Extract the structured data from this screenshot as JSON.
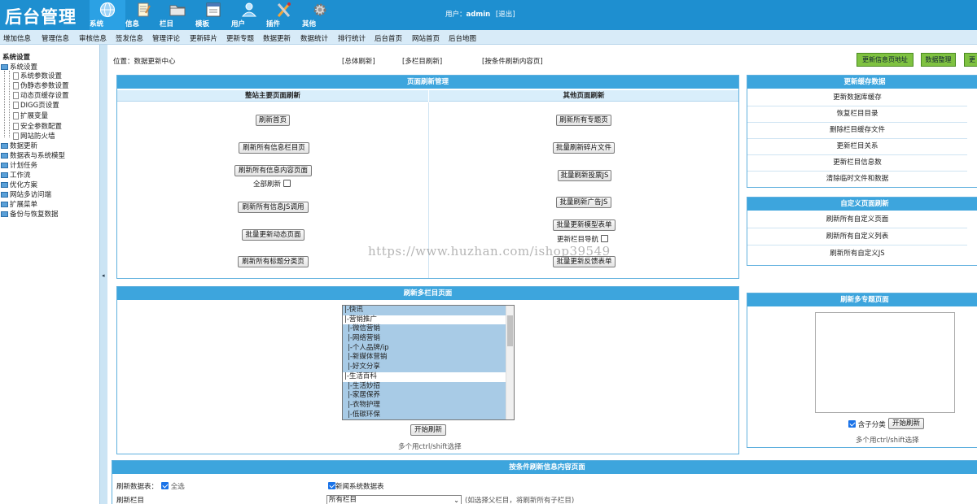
{
  "app": {
    "logo": "后台管理",
    "user_label": "用户：",
    "user_name": "admin",
    "logout": "[退出]"
  },
  "topnav": [
    {
      "label": "系统",
      "icon": "globe-icon",
      "active": true
    },
    {
      "label": "信息",
      "icon": "notepad-icon"
    },
    {
      "label": "栏目",
      "icon": "folder-icon"
    },
    {
      "label": "模板",
      "icon": "window-icon"
    },
    {
      "label": "用户",
      "icon": "user-icon"
    },
    {
      "label": "插件",
      "icon": "tools-icon"
    },
    {
      "label": "其他",
      "icon": "gear-icon"
    }
  ],
  "menubar": [
    "增加信息",
    "管理信息",
    "审核信息",
    "签发信息",
    "管理评论",
    "更新碎片",
    "更新专题",
    "数据更新",
    "数据统计",
    "排行统计",
    "后台首页",
    "网站首页",
    "后台地图"
  ],
  "sidebar": {
    "title": "系统设置",
    "groups": [
      {
        "label": "系统设置",
        "children": [
          "系统参数设置",
          "伪静态参数设置",
          "动态页缓存设置",
          "DIGG页设置",
          "扩展变量",
          "安全参数配置",
          "网站防火墙"
        ]
      },
      {
        "label": "数据更新"
      },
      {
        "label": "数据表与系统模型"
      },
      {
        "label": "计划任务"
      },
      {
        "label": "工作流"
      },
      {
        "label": "优化方案"
      },
      {
        "label": "网站多访问端"
      },
      {
        "label": "扩展菜单"
      },
      {
        "label": "备份与恢复数据"
      }
    ]
  },
  "splitter_arrow": "◂",
  "location": {
    "prefix": "位置：",
    "current": "数据更新中心"
  },
  "toplinks": [
    "[总体刷新]",
    "[多栏目刷新]",
    "[按条件刷新内容页]"
  ],
  "green_buttons": [
    "更新信息页地址",
    "数据整理",
    "更"
  ],
  "page_refresh": {
    "title": "页面刷新管理",
    "left_title": "整站主要页面刷新",
    "right_title": "其他页面刷新",
    "left_buttons": [
      "刷新首页",
      "刷新所有信息栏目页",
      "刷新所有信息内容页面",
      "刷新所有信息JS调用",
      "批量更新动态页面",
      "刷新所有标题分类页"
    ],
    "full_refresh_label": "全部刷新",
    "right_buttons": [
      "刷新所有专题页",
      "批量刷新碎片文件",
      "批量刷新投票JS",
      "批量刷新广告JS",
      "批量更新模型表单",
      "批量更新反馈表单"
    ],
    "update_nav_label": "更新栏目导航"
  },
  "cache": {
    "title": "更新缓存数据",
    "items": [
      "更新数据库缓存",
      "恢复栏目目录",
      "删除栏目缓存文件",
      "更新栏目关系",
      "更新栏目信息数",
      "清除临时文件和数据"
    ]
  },
  "custom": {
    "title": "自定义页面刷新",
    "items": [
      "刷新所有自定义页面",
      "刷新所有自定义列表",
      "刷新所有自定义JS"
    ]
  },
  "multi_column": {
    "title": "刷新多栏目页面",
    "options": [
      {
        "text": "|-快讯",
        "child": false
      },
      {
        "text": "|-营销推广",
        "child": false
      },
      {
        "text": "|-微信营销",
        "child": true
      },
      {
        "text": "|-网络营销",
        "child": true
      },
      {
        "text": "|-个人品牌/ip",
        "child": true
      },
      {
        "text": "|-新媒体营销",
        "child": true
      },
      {
        "text": "|-好文分享",
        "child": true
      },
      {
        "text": "|-生活百科",
        "child": false
      },
      {
        "text": "|-生活妙招",
        "child": true
      },
      {
        "text": "|-家居保养",
        "child": true
      },
      {
        "text": "|-衣物护理",
        "child": true
      },
      {
        "text": "|-低碳环保",
        "child": true
      }
    ],
    "start_button": "开始刷新",
    "hint": "多个用ctrl/shift选择"
  },
  "multi_topic": {
    "title": "刷新多专题页面",
    "include_label": "含子分类",
    "start_button": "开始刷新",
    "hint": "多个用ctrl/shift选择"
  },
  "condition": {
    "title": "按条件刷新信息内容页面",
    "table_label": "刷新数据表：",
    "select_all": "全选",
    "news_table": "新闻系统数据表",
    "column_label": "刷新栏目",
    "column_value": "所有栏目",
    "column_hint": "(如选择父栏目，将刷新所有子栏目)"
  },
  "watermark": "https://www.huzhan.com/ishop39549"
}
